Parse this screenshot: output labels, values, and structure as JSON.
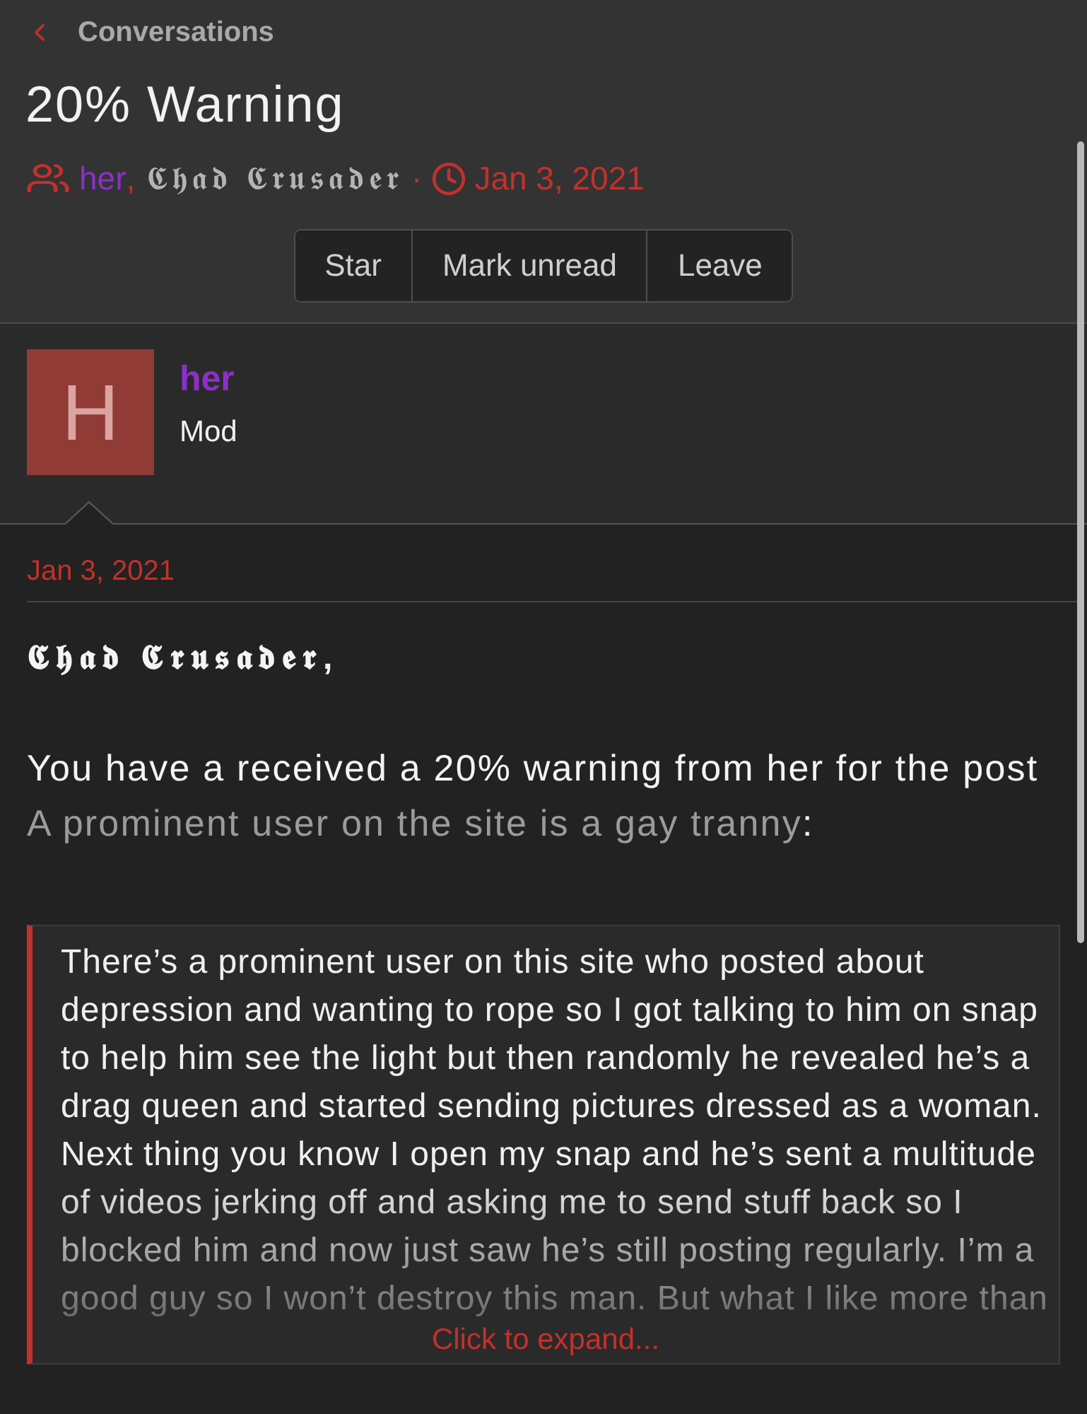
{
  "header": {
    "back_label": "Conversations"
  },
  "title": "20% Warning",
  "meta": {
    "participants": [
      {
        "name": "her",
        "color": "#8b2fc9"
      },
      {
        "name": "𝕮𝖍𝖆𝖉 𝕮𝖗𝖚𝖘𝖆𝖉𝖊𝖗",
        "color": "#b4b4b4"
      }
    ],
    "name_separator": ",",
    "dot": "·",
    "date": "Jan 3, 2021"
  },
  "actions": [
    "Star",
    "Mark unread",
    "Leave"
  ],
  "message": {
    "author": {
      "initial": "H",
      "name": "her",
      "title": "Mod"
    },
    "date": "Jan 3, 2021",
    "greeting": "𝕮𝖍𝖆𝖉 𝕮𝖗𝖚𝖘𝖆𝖉𝖊𝖗,",
    "body": "You have a received a 20% warning from her for the post",
    "post_link": "A prominent user on the site is a gay tranny",
    "post_suffix": ":",
    "quote": {
      "text": "There’s a prominent user on this site who posted about depression and wanting to rope so I got talking to him on snap to help him see the light but then randomly he revealed he’s a drag queen and started sending pictures dressed as a woman. Next thing you know I open my snap and he’s sent a multitude of videos jerking off and asking me to send stuff back so I blocked him and now just saw he’s still posting regularly. I’m a good guy so I won’t destroy this man. But what I like more than",
      "expand_label": "Click to expand..."
    }
  }
}
